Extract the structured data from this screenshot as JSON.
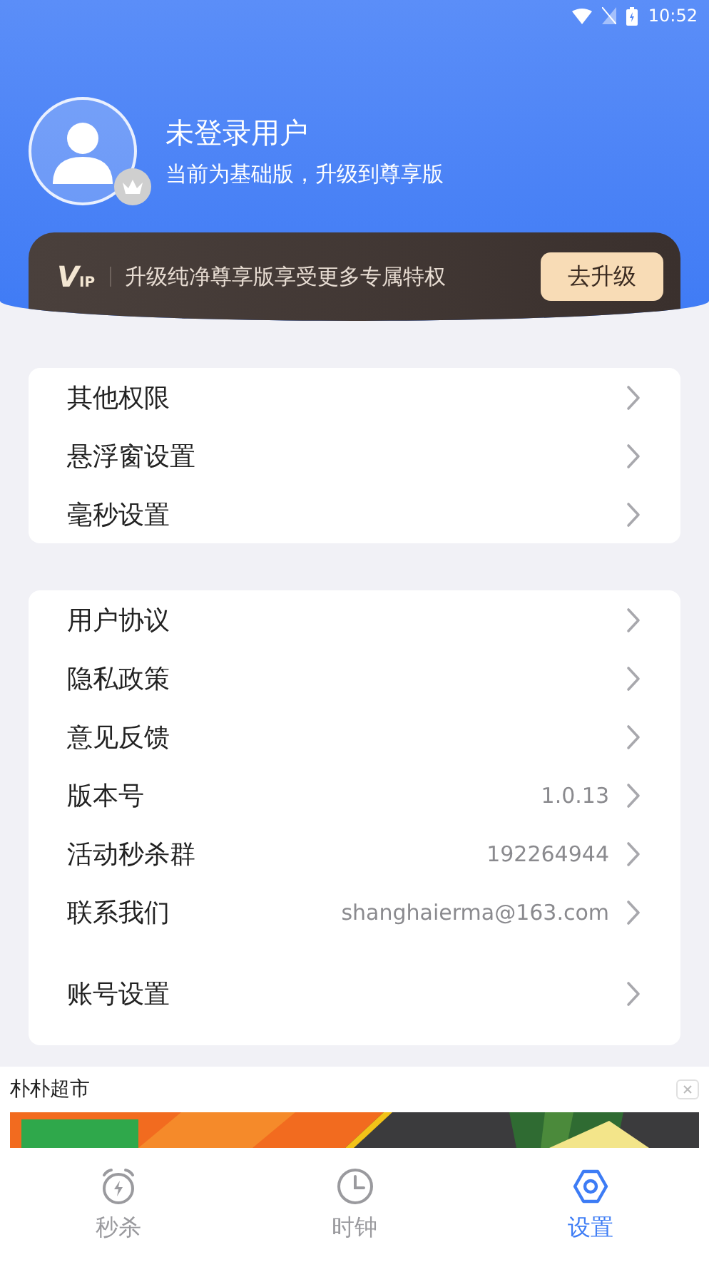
{
  "status_bar": {
    "time": "10:52"
  },
  "profile": {
    "name": "未登录用户",
    "subtitle": "当前为基础版，升级到尊享版"
  },
  "vip_banner": {
    "logo": "V",
    "logo_sub": "IP",
    "text": "升级纯净尊享版享受更多专属特权",
    "button": "去升级"
  },
  "cards": [
    {
      "rows": [
        {
          "kind": "row",
          "label": "其他权限"
        },
        {
          "kind": "row",
          "label": "悬浮窗设置"
        },
        {
          "kind": "row",
          "label": "毫秒设置"
        }
      ]
    },
    {
      "rows": [
        {
          "kind": "row",
          "label": "用户协议"
        },
        {
          "kind": "row",
          "label": "隐私政策"
        },
        {
          "kind": "row",
          "label": "意见反馈"
        },
        {
          "kind": "row",
          "label": "版本号",
          "value": "1.0.13"
        },
        {
          "kind": "row",
          "label": "活动秒杀群",
          "value": "192264944"
        },
        {
          "kind": "row",
          "label": "联系我们",
          "value": "shanghaierma@163.com"
        },
        {
          "kind": "spaced",
          "label": "账号设置"
        }
      ]
    }
  ],
  "ad": {
    "title": "朴朴超市",
    "kind": "picture"
  },
  "tabs": [
    {
      "label": "秒杀",
      "kind": "alarm",
      "selected": false
    },
    {
      "label": "时钟",
      "kind": "clock",
      "selected": false
    },
    {
      "label": "设置",
      "kind": "gear",
      "selected": true
    }
  ]
}
